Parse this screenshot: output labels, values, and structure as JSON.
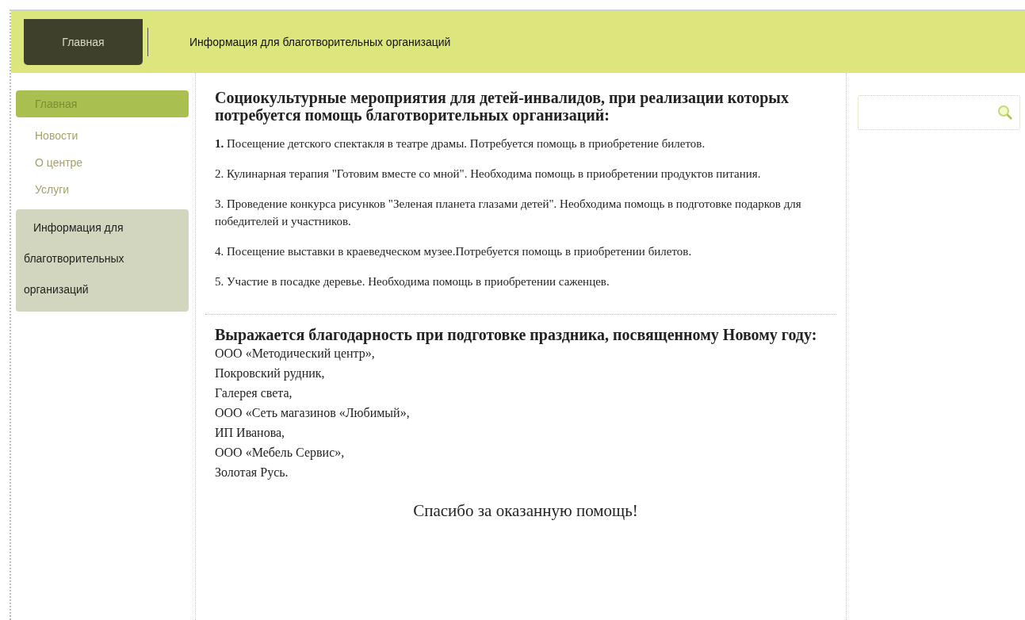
{
  "top_nav": {
    "tabs": [
      {
        "label": "Главная",
        "selected": true
      },
      {
        "label": "Информация для благотворительных организаций",
        "selected": false
      }
    ]
  },
  "sidebar": {
    "items": [
      {
        "label": "Главная",
        "kind": "link",
        "selected": true
      },
      {
        "label": "Новости",
        "kind": "link",
        "selected": false
      },
      {
        "label": "О центре",
        "kind": "link",
        "selected": false
      },
      {
        "label": "Услуги",
        "kind": "link",
        "selected": false
      },
      {
        "label": "Информация для благотворительных организаций",
        "kind": "block",
        "selected": false
      }
    ]
  },
  "content": {
    "heading": "Социокультурные мероприятия для детей-инвалидов, при реализации которых потребуется помощь благотворительных организаций:",
    "items": [
      "**1.** Посещение детского спектакля в театре драмы. Потребуется помощь в приобретение билетов.",
      "2. Кулинарная терапия \"Готовим вместе со мной\". Необходима помощь в приобретении продуктов питания.",
      "3. Проведение конкурса рисунков \"Зеленая планета глазами детей\". Необходима помощь в подготовке подарков для победителей и участников.",
      "4. Посещение выставки в краеведческом музее.Потребуется помощь в приобретении билетов.",
      "5. Участие в посадке деревье. Необходима помощь в приобретении саженцев."
    ],
    "thanks_heading": "Выражается благодарность при подготовке праздника, посвященному Новому году:",
    "sponsors": [
      "ООО «Методический центр»,",
      "Покровский рудник,",
      "Галерея света,",
      "ООО «Сеть магазинов «Любимый»,",
      "ИП Иванова,",
      "ООО «Мебель Сервис»,",
      "Золотая Русь."
    ],
    "closing": "Спасибо за оказанную помощь!"
  }
}
